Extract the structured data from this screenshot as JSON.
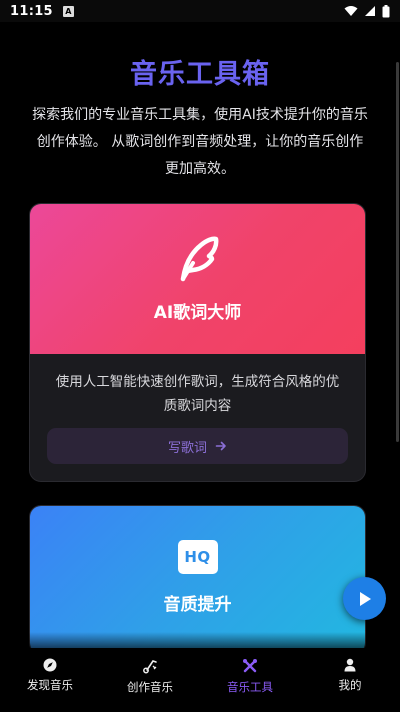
{
  "status_bar": {
    "time": "11:15",
    "notification_letter": "A"
  },
  "page": {
    "title": "音乐工具箱",
    "intro": "探索我们的专业音乐工具集，使用AI技术提升你的音乐创作体验。 从歌词创作到音频处理，让你的音乐创作更加高效。"
  },
  "tools": [
    {
      "title": "AI歌词大师",
      "description": "使用人工智能快速创作歌词，生成符合风格的优质歌词内容",
      "button_label": "写歌词",
      "icon": "feather-icon",
      "color": "#ec4899"
    },
    {
      "title": "音质提升",
      "badge": "HQ",
      "icon": "hq-icon",
      "color": "#3b82f6"
    }
  ],
  "nav": [
    {
      "label": "发现音乐",
      "icon": "compass-icon",
      "active": false
    },
    {
      "label": "创作音乐",
      "icon": "music-note-icon",
      "active": false
    },
    {
      "label": "音乐工具",
      "icon": "tools-icon",
      "active": true
    },
    {
      "label": "我的",
      "icon": "person-icon",
      "active": false
    }
  ],
  "colors": {
    "accent": "#8b5cf6",
    "title": "#6a63f0",
    "fab": "#1e7fe6"
  }
}
